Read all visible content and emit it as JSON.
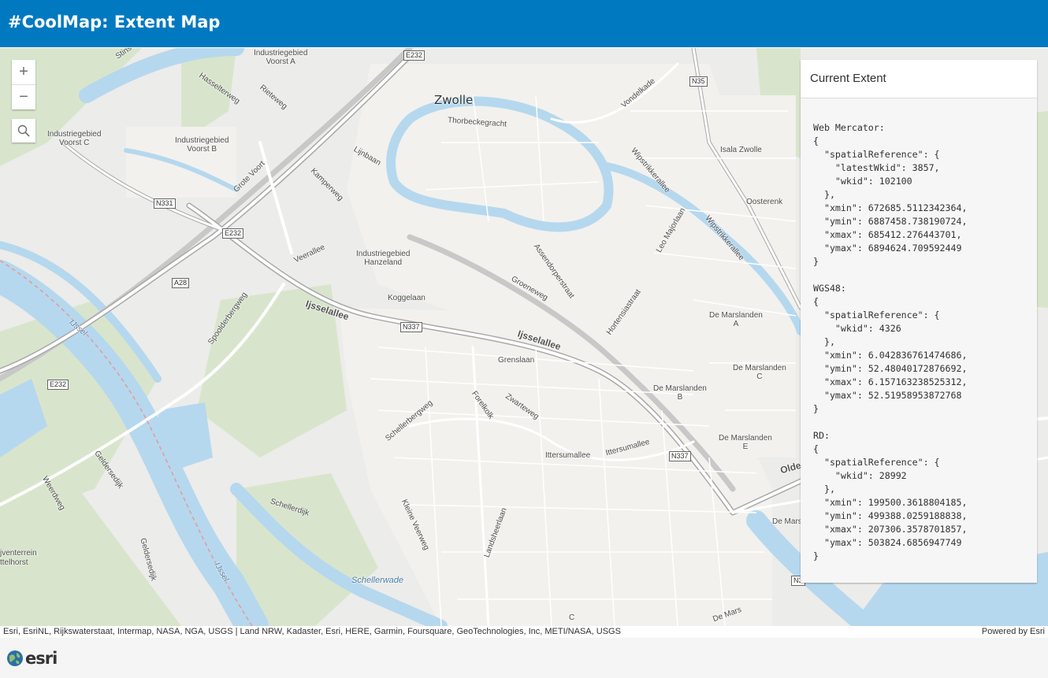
{
  "header": {
    "title": "#CoolMap: Extent Map"
  },
  "map": {
    "controls": {
      "zoom_in": "+",
      "zoom_out": "−"
    },
    "labels": {
      "zwolle": "Zwolle",
      "thorbeckegracht": "Thorbeckegracht",
      "vondelkade": "Vondelkade",
      "isala": "Isala Zwolle",
      "oosterenk": "Oosterenk",
      "wipstrikkerallee1": "Wipstrikkerallee",
      "wipstrikkerallee2": "Wipstrikkerallee",
      "leomajorlaan": "Leo Majorlaan",
      "industrie_a_1": "Industriegebied",
      "industrie_a_2": "Voorst A",
      "industrie_b_1": "Industriegebied",
      "industrie_b_2": "Voorst B",
      "industrie_c_1": "Industriegebied",
      "industrie_c_2": "Voorst C",
      "hasselterweg": "Hasselterweg",
      "rieteweg": "Rieteweg",
      "lijnbaan": "Lijnbaan",
      "grotevoort": "Grote Voort",
      "kamperweg": "Kamperweg",
      "veerallee": "Veerallee",
      "hanzeland_1": "Industriegebied",
      "hanzeland_2": "Hanzeland",
      "assendorperstraat": "Assendorperstraat",
      "groeneweg": "Groeneweg",
      "hortensiastraat": "Hortensiastraat",
      "koggelaan": "Koggelaan",
      "ijsselallee1": "Ijsselallee",
      "ijsselallee2": "Ijsselallee",
      "grenslaan": "Grenslaan",
      "spoolderbergweg": "Spoolderbergweg",
      "ijssel1": "IJssel",
      "ijssel2": "IJssel",
      "schellerbergweg": "Schellerbergweg",
      "forelkolk": "Forelkolk",
      "zwarteweg": "Zwarteweg",
      "ittersumallee1": "Ittersumallee",
      "ittersumallee2": "Ittersumallee",
      "schellerdijk": "Schellerdijk",
      "kleineveerweg": "Kleine Veerweg",
      "landsheerlaan": "Landsheerlaan",
      "schellerwade": "Schellerwade",
      "geldersedijk1": "Geldersedijk",
      "geldersedijk2": "Geldersedijk",
      "weerdweg": "Weerdweg",
      "stins": "Stins",
      "marslanden_a_1": "De Marslanden",
      "marslanden_a_2": "A",
      "marslanden_c_1": "De Marslanden",
      "marslanden_c_2": "C",
      "marslanden_b_1": "De Marslanden",
      "marslanden_b_2": "B",
      "marslanden_e_1": "De Marslanden",
      "marslanden_e_2": "E",
      "demars1": "De Mars",
      "demars2": "De Mars",
      "olde": "Olde",
      "c": "C",
      "verrein_1": "jventerrein",
      "verrein_2": "ttelhorst"
    },
    "shields": {
      "e232_top": "E232",
      "n35": "N35",
      "n331": "N331",
      "e232_mid": "E232",
      "a28": "A28",
      "n337_a": "N337",
      "e232_left": "E232",
      "n337_b": "N337",
      "n3": "N3"
    }
  },
  "panel": {
    "title": "Current Extent",
    "content": "Web Mercator:\n{\n  \"spatialReference\": {\n    \"latestWkid\": 3857,\n    \"wkid\": 102100\n  },\n  \"xmin\": 672685.5112342364,\n  \"ymin\": 6887458.738190724,\n  \"xmax\": 685412.276443701,\n  \"ymax\": 6894624.709592449\n}\n\nWGS48:\n{\n  \"spatialReference\": {\n    \"wkid\": 4326\n  },\n  \"xmin\": 6.042836761474686,\n  \"ymin\": 52.48040172876692,\n  \"xmax\": 6.157163238525312,\n  \"ymax\": 52.51958953872768\n}\n\nRD:\n{\n  \"spatialReference\": {\n    \"wkid\": 28992\n  },\n  \"xmin\": 199500.3618804185,\n  \"ymin\": 499388.0259188838,\n  \"xmax\": 207306.3578701857,\n  \"ymax\": 503824.6856947749\n}"
  },
  "attribution": {
    "sources": "Esri, EsriNL, Rijkswaterstaat, Intermap, NASA, NGA, USGS | Land NRW, Kadaster, Esri, HERE, Garmin, Foursquare, GeoTechnologies, Inc, METI/NASA, USGS",
    "powered": "Powered by Esri"
  },
  "footer": {
    "logo_text": "esri"
  },
  "colors": {
    "header": "#0079c1",
    "water": "#b5d8ee",
    "land": "#ececea",
    "green": "#d8e5cc"
  }
}
